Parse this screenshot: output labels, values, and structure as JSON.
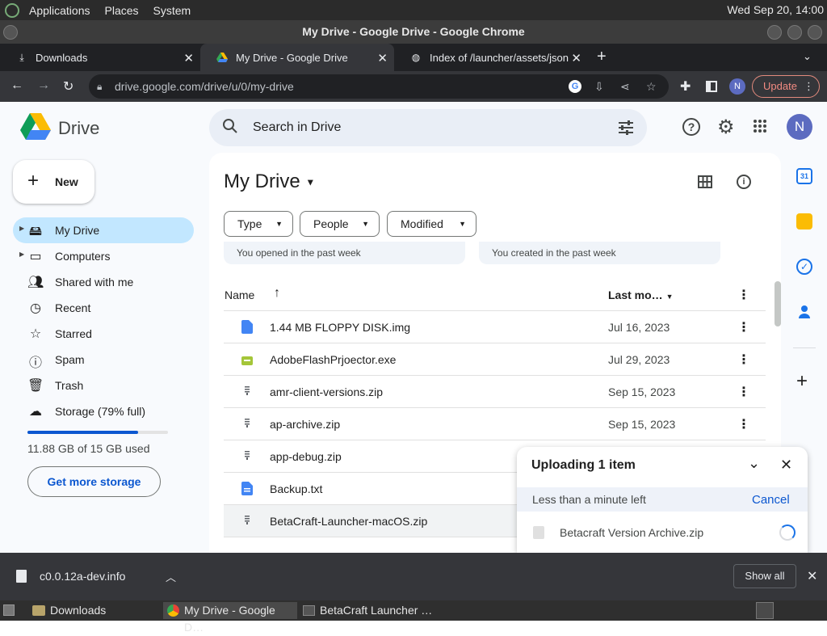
{
  "os": {
    "menus": [
      "Applications",
      "Places",
      "System"
    ],
    "clock": "Wed Sep 20, 14:00"
  },
  "window": {
    "title": "My Drive - Google Drive - Google Chrome"
  },
  "tabs": [
    {
      "label": "Downloads",
      "icon": "download-icon"
    },
    {
      "label": "My Drive - Google Drive",
      "icon": "google-drive-icon"
    },
    {
      "label": "Index of /launcher/assets/jsons",
      "icon": "globe-icon"
    }
  ],
  "omnibox": {
    "url": "drive.google.com/drive/u/0/my-drive"
  },
  "toolbar": {
    "update_label": "Update",
    "profile_initial": "N"
  },
  "drive": {
    "logo": "Drive",
    "search_placeholder": "Search in Drive",
    "avatar_initial": "N",
    "new_label": "New",
    "nav": [
      {
        "label": "My Drive",
        "icon": "my-drive-icon"
      },
      {
        "label": "Computers",
        "icon": "computer-icon"
      },
      {
        "label": "Shared with me",
        "icon": "people-icon"
      },
      {
        "label": "Recent",
        "icon": "clock-icon"
      },
      {
        "label": "Starred",
        "icon": "star-icon"
      },
      {
        "label": "Spam",
        "icon": "spam-icon"
      },
      {
        "label": "Trash",
        "icon": "trash-icon"
      },
      {
        "label": "Storage (79% full)",
        "icon": "cloud-icon"
      }
    ],
    "storage_used": "11.88 GB of 15 GB used",
    "storage_fraction": 0.79,
    "get_storage_label": "Get more storage",
    "title": "My Drive",
    "filters": [
      "Type",
      "People",
      "Modified"
    ],
    "suggestions": [
      "You opened in the past week",
      "You created in the past week"
    ],
    "columns": {
      "name": "Name",
      "modified": "Last mo…"
    },
    "files": [
      {
        "name": "1.44 MB FLOPPY DISK.img",
        "date": "Jul 16, 2023",
        "icon": "doc-icon"
      },
      {
        "name": "AdobeFlashPrjoector.exe",
        "date": "Jul 29, 2023",
        "icon": "exe-icon"
      },
      {
        "name": "amr-client-versions.zip",
        "date": "Sep 15, 2023",
        "icon": "zip-icon"
      },
      {
        "name": "ap-archive.zip",
        "date": "Sep 15, 2023",
        "icon": "zip-icon"
      },
      {
        "name": "app-debug.zip",
        "date": "",
        "icon": "zip-icon"
      },
      {
        "name": "Backup.txt",
        "date": "",
        "icon": "doc-icon"
      },
      {
        "name": "BetaCraft-Launcher-macOS.zip",
        "date": "",
        "icon": "zip-icon"
      }
    ],
    "upload": {
      "title": "Uploading 1 item",
      "eta": "Less than a minute left",
      "cancel": "Cancel",
      "file": "Betacraft Version Archive.zip"
    }
  },
  "download_bar": {
    "file": "c0.0.12a-dev.info",
    "show_all": "Show all"
  },
  "taskbar": [
    {
      "label": "Downloads"
    },
    {
      "label": "My Drive - Google D…"
    },
    {
      "label": "BetaCraft Launcher …"
    }
  ],
  "colors": {
    "accent": "#0b57d0",
    "active_nav": "#c2e7ff",
    "avatar": "#5c6bc0"
  }
}
